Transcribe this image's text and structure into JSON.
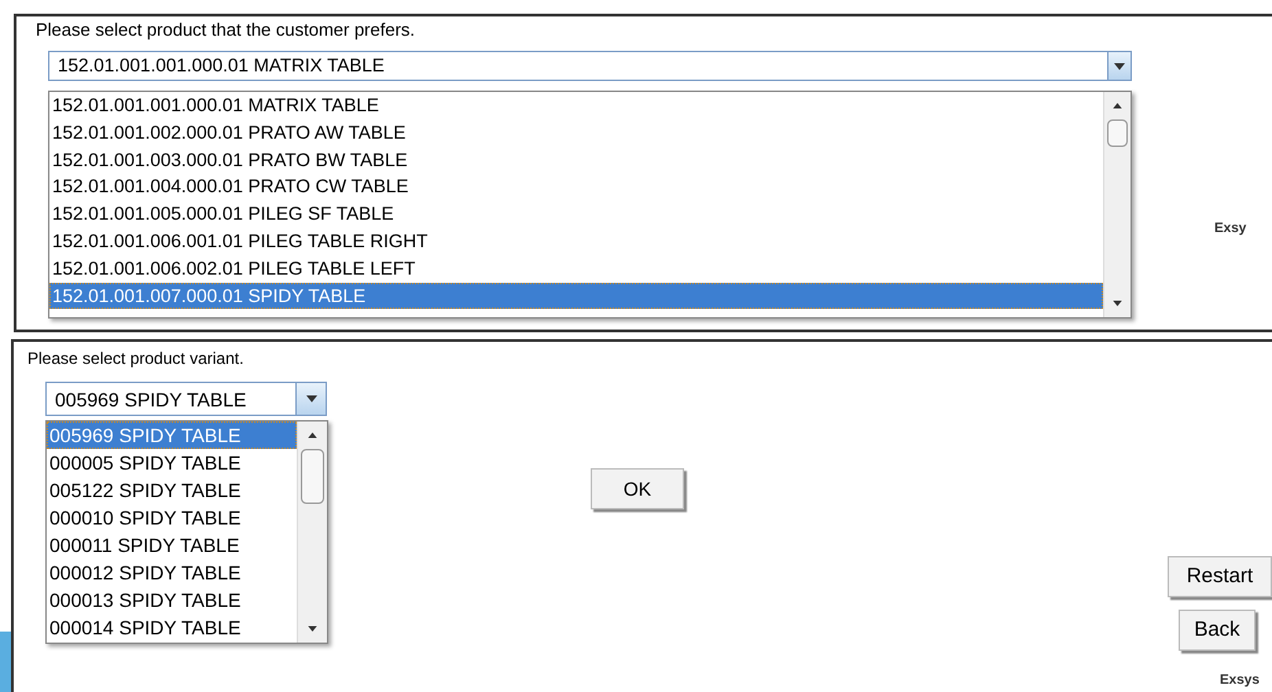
{
  "product_panel": {
    "prompt": "Please select product that the customer prefers.",
    "combo": {
      "value": "152.01.001.001.000.01 MATRIX TABLE"
    },
    "options": [
      {
        "label": "152.01.001.001.000.01 MATRIX TABLE",
        "selected": false
      },
      {
        "label": "152.01.001.002.000.01 PRATO AW TABLE",
        "selected": false
      },
      {
        "label": "152.01.001.003.000.01 PRATO BW TABLE",
        "selected": false
      },
      {
        "label": "152.01.001.004.000.01 PRATO CW TABLE",
        "selected": false
      },
      {
        "label": "152.01.001.005.000.01 PILEG SF TABLE",
        "selected": false
      },
      {
        "label": "152.01.001.006.001.01 PILEG TABLE RIGHT",
        "selected": false
      },
      {
        "label": "152.01.001.006.002.01 PILEG TABLE LEFT",
        "selected": false
      },
      {
        "label": "152.01.001.007.000.01 SPIDY TABLE",
        "selected": true
      }
    ],
    "brand": "Exsy"
  },
  "variant_panel": {
    "prompt": "Please select product variant.",
    "combo": {
      "value": "005969 SPIDY TABLE"
    },
    "options": [
      {
        "label": "005969 SPIDY TABLE",
        "selected": true
      },
      {
        "label": "000005 SPIDY TABLE",
        "selected": false
      },
      {
        "label": "005122 SPIDY TABLE",
        "selected": false
      },
      {
        "label": "000010 SPIDY TABLE",
        "selected": false
      },
      {
        "label": "000011 SPIDY TABLE",
        "selected": false
      },
      {
        "label": "000012 SPIDY TABLE",
        "selected": false
      },
      {
        "label": "000013 SPIDY TABLE",
        "selected": false
      },
      {
        "label": "000014 SPIDY TABLE",
        "selected": false
      }
    ],
    "ok_button": "OK",
    "restart_button": "Restart",
    "back_button": "Back",
    "brand": "Exsys"
  }
}
